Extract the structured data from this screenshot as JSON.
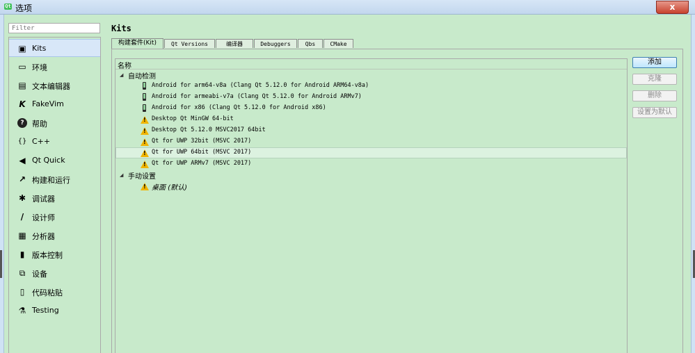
{
  "window": {
    "title": "选项",
    "close_label": "x"
  },
  "filter": {
    "placeholder": "Filter"
  },
  "sidebar": {
    "items": [
      {
        "label": "Kits",
        "icon": "▣"
      },
      {
        "label": "环境",
        "icon": "▭"
      },
      {
        "label": "文本编辑器",
        "icon": "▤"
      },
      {
        "label": "FakeVim",
        "icon": "K"
      },
      {
        "label": "帮助",
        "icon": "?"
      },
      {
        "label": "C++",
        "icon": "{}"
      },
      {
        "label": "Qt Quick",
        "icon": "◀"
      },
      {
        "label": "构建和运行",
        "icon": "↗"
      },
      {
        "label": "调试器",
        "icon": "✱"
      },
      {
        "label": "设计师",
        "icon": "/"
      },
      {
        "label": "分析器",
        "icon": "▦"
      },
      {
        "label": "版本控制",
        "icon": "▮"
      },
      {
        "label": "设备",
        "icon": "⧉"
      },
      {
        "label": "代码粘贴",
        "icon": "▯"
      },
      {
        "label": "Testing",
        "icon": "⚗"
      }
    ],
    "selected_index": 0
  },
  "page": {
    "title": "Kits"
  },
  "tabs": [
    {
      "label": "构建套件(Kit)"
    },
    {
      "label": "Qt Versions"
    },
    {
      "label": "编译器"
    },
    {
      "label": "Debuggers"
    },
    {
      "label": "Qbs"
    },
    {
      "label": "CMake"
    }
  ],
  "tree": {
    "header": "名称",
    "groups": [
      {
        "label": "自动检测",
        "expander": "◢",
        "items": [
          {
            "label": "Android for arm64-v8a (Clang Qt 5.12.0 for Android ARM64-v8a)",
            "icon": "android-device-icon"
          },
          {
            "label": "Android for armeabi-v7a (Clang Qt 5.12.0 for Android ARMv7)",
            "icon": "android-device-icon"
          },
          {
            "label": "Android for x86 (Clang Qt 5.12.0 for Android x86)",
            "icon": "android-device-icon"
          },
          {
            "label": "Desktop Qt  MinGW 64-bit",
            "icon": "warning-icon"
          },
          {
            "label": "Desktop Qt 5.12.0 MSVC2017 64bit",
            "icon": "warning-icon"
          },
          {
            "label": "Qt  for UWP 32bit (MSVC 2017)",
            "icon": "warning-icon"
          },
          {
            "label": "Qt  for UWP 64bit (MSVC 2017)",
            "icon": "warning-icon"
          },
          {
            "label": "Qt  for UWP ARMv7 (MSVC 2017)",
            "icon": "warning-icon"
          }
        ]
      },
      {
        "label": "手动设置",
        "expander": "◢",
        "items": [
          {
            "label": "桌面 (默认)",
            "icon": "warning-icon"
          }
        ]
      }
    ],
    "highlighted": "Qt  for UWP 64bit (MSVC 2017)"
  },
  "buttons": {
    "add": "添加",
    "clone": "克隆",
    "remove": "删除",
    "make_default": "设置为默认"
  }
}
